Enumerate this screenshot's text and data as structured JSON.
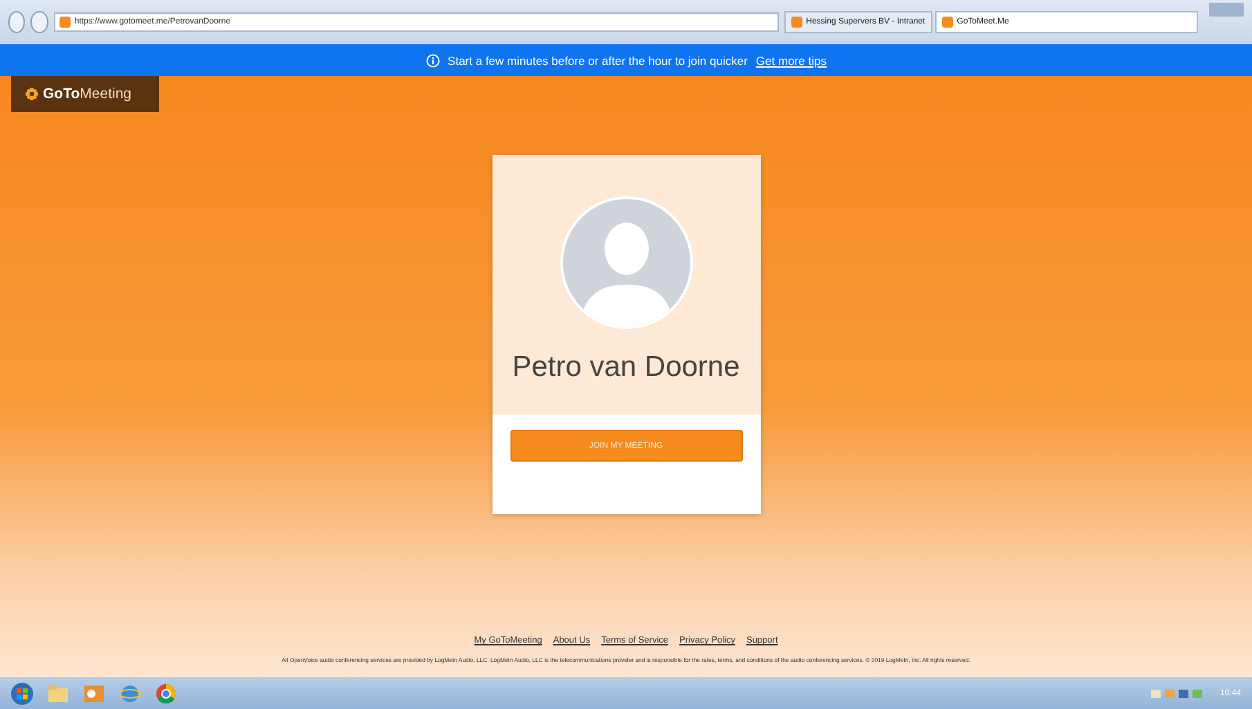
{
  "browser": {
    "address": "https://www.gotomeet.me/PetrovanDoorne",
    "tabs": [
      {
        "label": "Hessing Supervers BV - Intranet",
        "selected": false
      },
      {
        "label": "GoToMeet.Me",
        "selected": true
      }
    ]
  },
  "banner": {
    "message": "Start a few minutes before or after the hour to join quicker",
    "link": "Get more tips"
  },
  "logo": {
    "brand_bold": "GoTo",
    "brand_light": "Meeting"
  },
  "profile": {
    "name": "Petro van Doorne",
    "button": "JOIN MY MEETING"
  },
  "footer": {
    "links": [
      "My GoToMeeting",
      "About Us",
      "Terms of Service",
      "Privacy Policy",
      "Support"
    ],
    "disclaimer": "All OpenVoice audio conferencing services are provided by LogMeIn Audio, LLC. LogMeIn Audio, LLC is the telecommunications provider and is responsible for the rates, terms, and conditions of the audio conferencing services. © 2019 LogMeIn, Inc. All rights reserved."
  },
  "taskbar": {
    "clock": "10:44"
  }
}
